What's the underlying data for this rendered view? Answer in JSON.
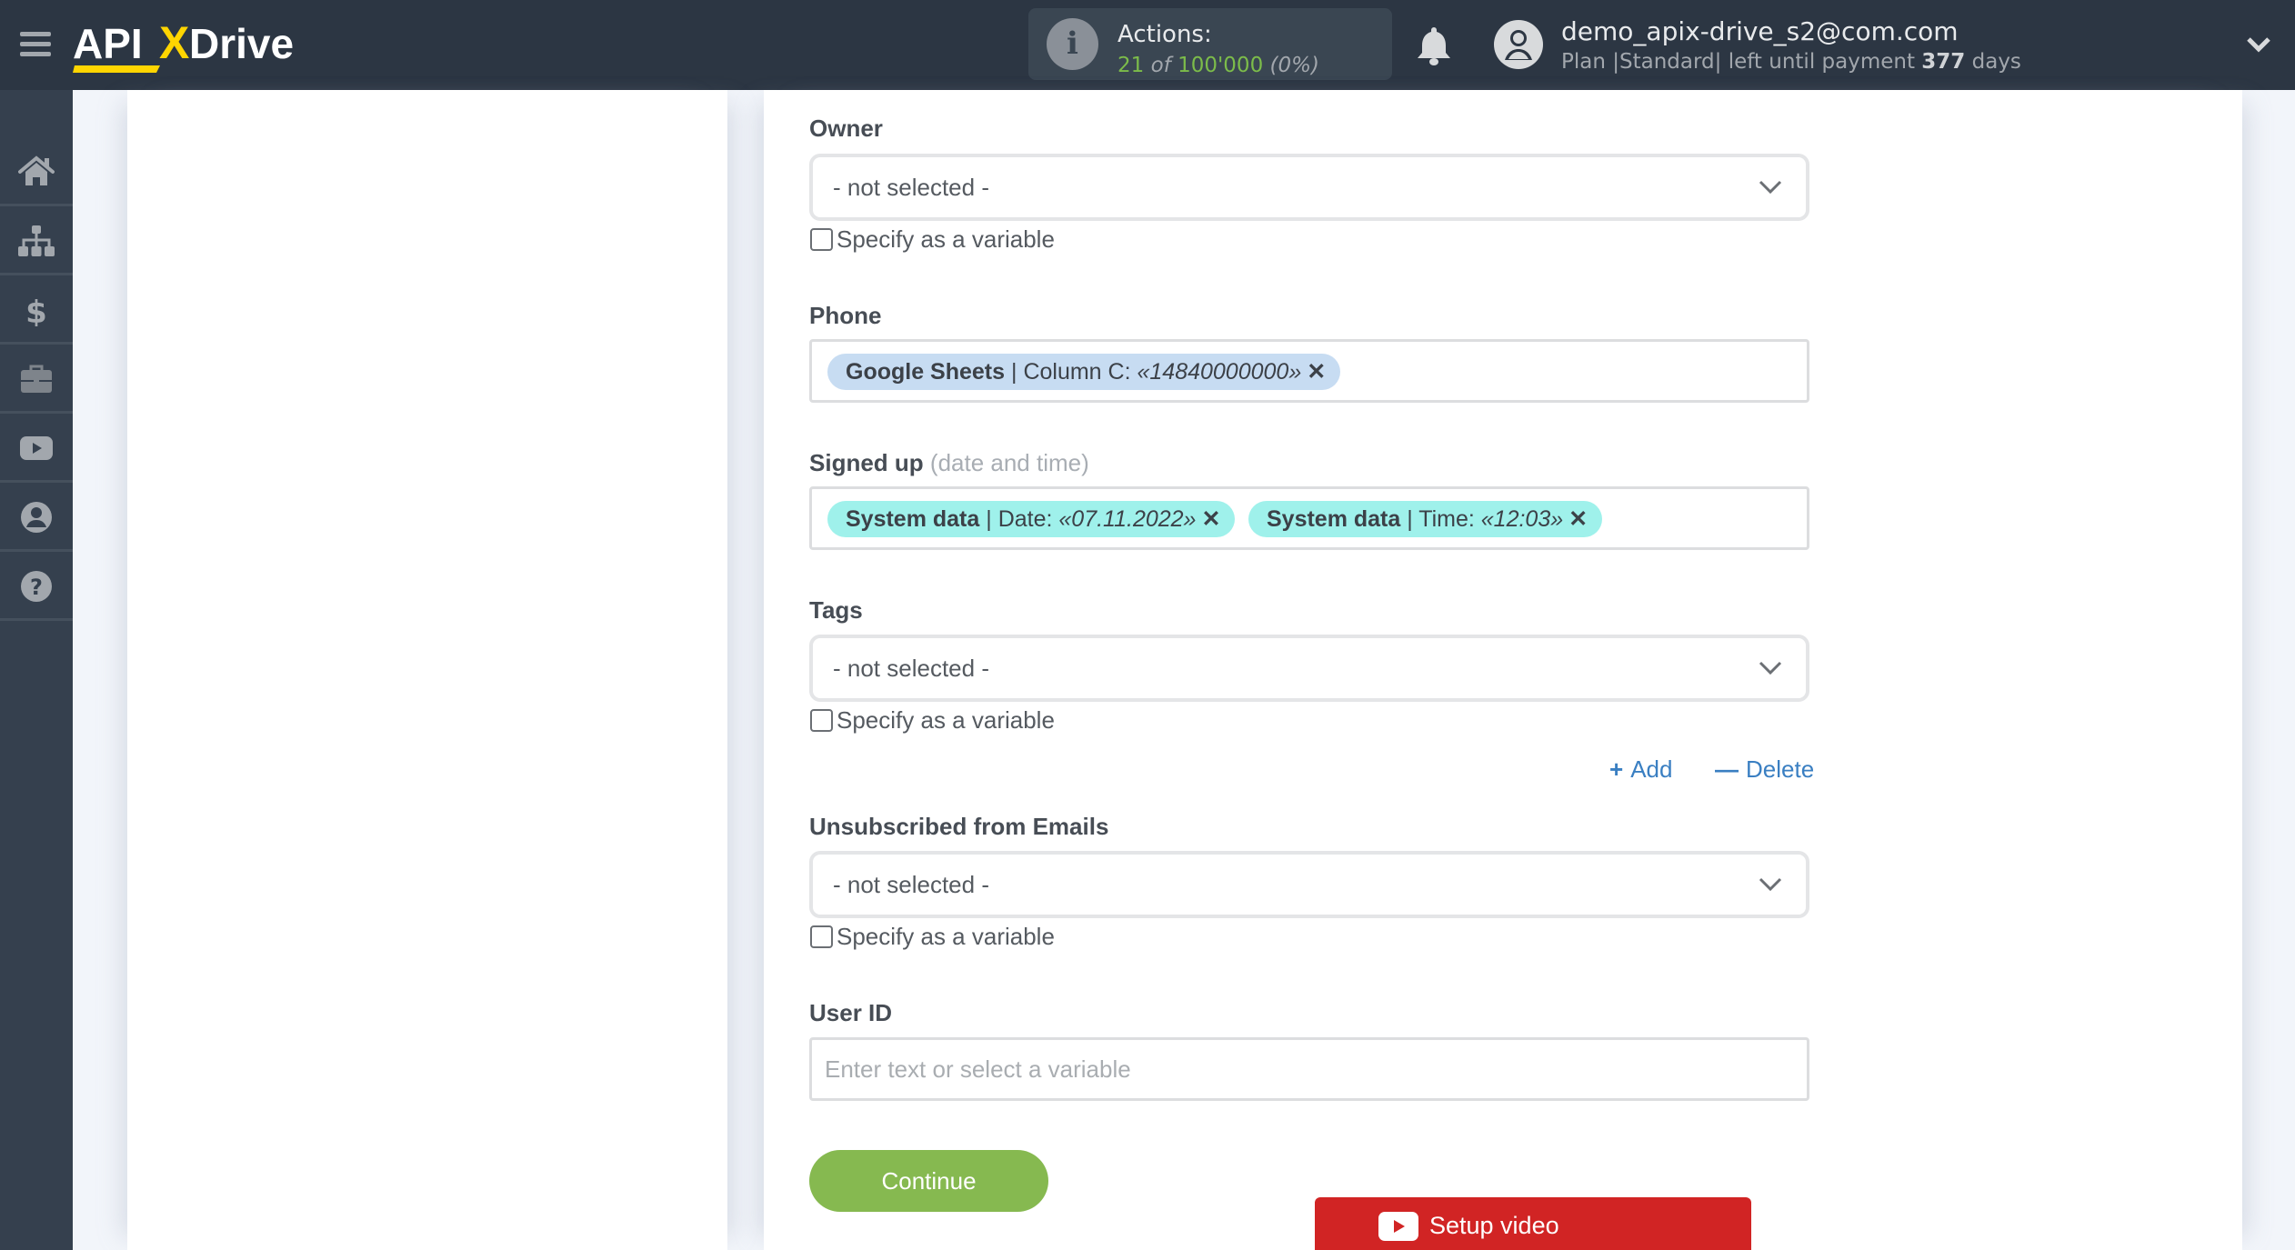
{
  "header": {
    "logo_text_left": "API",
    "logo_text_x": "X",
    "logo_text_right": "Drive",
    "actions_label": "Actions:",
    "actions_used": "21",
    "actions_of": "of",
    "actions_total": "100'000",
    "actions_percent": "(0%)",
    "user_email": "demo_apix-drive_s2@com.com",
    "plan_prefix": "Plan |",
    "plan_name": "Standard",
    "plan_middle": "| left until payment",
    "plan_days": "377",
    "plan_suffix": "days",
    "colors": {
      "bg": "#2c3643",
      "accent_green": "#7cbc4a",
      "logo_yellow": "#ffd500"
    }
  },
  "sidebar": {
    "items": [
      {
        "name": "home",
        "icon": "home-icon"
      },
      {
        "name": "connections",
        "icon": "sitemap-icon"
      },
      {
        "name": "billing",
        "icon": "dollar-icon"
      },
      {
        "name": "services",
        "icon": "briefcase-icon"
      },
      {
        "name": "video-tutorials",
        "icon": "youtube-icon"
      },
      {
        "name": "account",
        "icon": "user-circle-icon"
      },
      {
        "name": "help",
        "icon": "question-circle-icon"
      }
    ]
  },
  "form": {
    "owner": {
      "label": "Owner",
      "value": "- not selected -",
      "checkbox_label": "Specify as a variable",
      "checked": false
    },
    "phone": {
      "label": "Phone",
      "chips": [
        {
          "source": "Google Sheets",
          "field": "| Column C: ",
          "value": "«14840000000»",
          "remove": "✕"
        }
      ]
    },
    "signed_up": {
      "label": "Signed up",
      "hint": "(date and time)",
      "chips": [
        {
          "source": "System data",
          "field": "| Date: ",
          "value": "«07.11.2022»",
          "remove": "✕"
        },
        {
          "source": "System data",
          "field": "| Time: ",
          "value": "«12:03»",
          "remove": "✕"
        }
      ]
    },
    "tags": {
      "label": "Tags",
      "value": "- not selected -",
      "checkbox_label": "Specify as a variable",
      "checked": false,
      "add_label": "Add",
      "delete_label": "Delete"
    },
    "unsubscribed": {
      "label": "Unsubscribed from Emails",
      "value": "- not selected -",
      "checkbox_label": "Specify as a variable",
      "checked": false
    },
    "user_id": {
      "label": "User ID",
      "value": "",
      "placeholder": "Enter text or select a variable"
    },
    "continue_label": "Continue",
    "setup_video_label": "Setup video"
  }
}
